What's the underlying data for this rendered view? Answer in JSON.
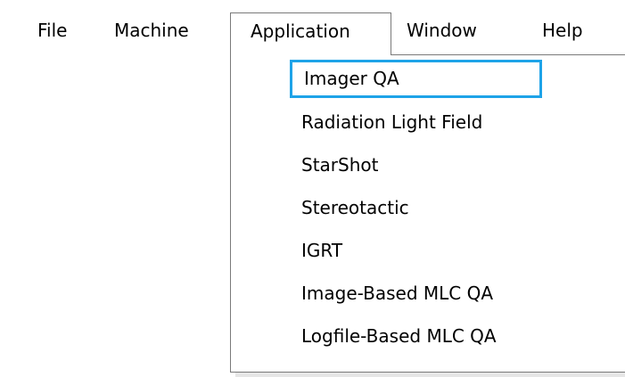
{
  "menubar": {
    "items": [
      {
        "label": "File"
      },
      {
        "label": "Machine"
      },
      {
        "label": "Application"
      },
      {
        "label": "Window"
      },
      {
        "label": "Help"
      }
    ]
  },
  "application_menu": {
    "items": [
      {
        "label": "Imager QA"
      },
      {
        "label": "Radiation Light Field"
      },
      {
        "label": "StarShot"
      },
      {
        "label": "Stereotactic"
      },
      {
        "label": "IGRT"
      },
      {
        "label": "Image-Based MLC QA"
      },
      {
        "label": "Logfile-Based MLC QA"
      }
    ]
  },
  "colors": {
    "focus_border": "#1ea3e8",
    "menu_border": "#7a7a7a"
  }
}
